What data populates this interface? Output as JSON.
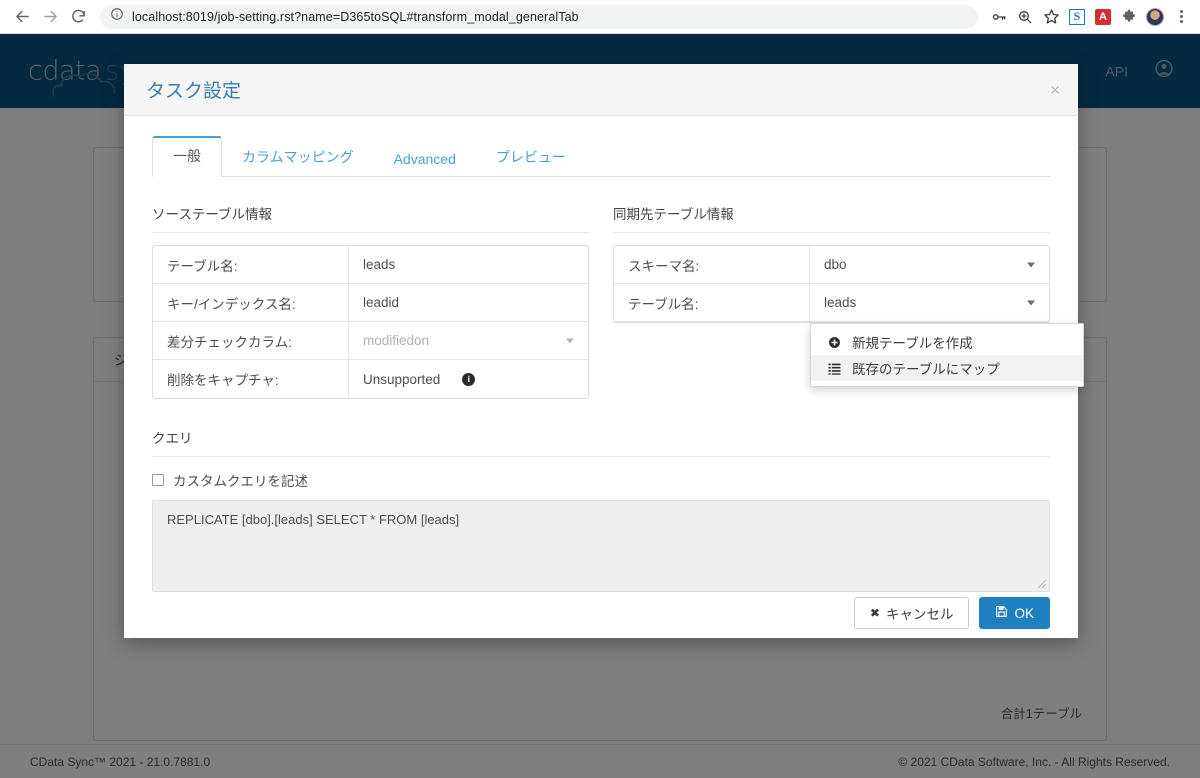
{
  "browser": {
    "back_icon": "arrow-left-icon",
    "forward_icon": "arrow-right-icon",
    "reload_icon": "reload-icon",
    "site_info_icon": "info-circle-icon",
    "url_host": "localhost:8019",
    "url_path": "/job-setting.rst?name=D365toSQL#transform_modal_generalTab",
    "url_full": "localhost:8019/job-setting.rst?name=D365toSQL#transform_modal_generalTab",
    "actions": [
      {
        "name": "password-key-icon",
        "glyph": "key"
      },
      {
        "name": "zoom-search-icon",
        "glyph": "magnifier"
      },
      {
        "name": "bookmark-star-icon",
        "glyph": "star"
      },
      {
        "name": "extension-s-icon",
        "label": "S"
      },
      {
        "name": "adobe-pdf-extension-icon",
        "label": "A"
      },
      {
        "name": "extensions-puzzle-icon",
        "glyph": "puzzle"
      },
      {
        "name": "profile-avatar",
        "glyph": "avatar"
      },
      {
        "name": "chrome-menu-icon",
        "glyph": "kebab"
      }
    ]
  },
  "navbar": {
    "brand_word": "cdata",
    "brand_product": "sync",
    "api_label": "API",
    "user_icon": "user-account-icon"
  },
  "page": {
    "jobs_panel_title": "ジ",
    "table_total": "合計1テーブル",
    "footer_left": "CData Sync™ 2021 - 21.0.7881.0",
    "footer_right": "© 2021 CData Software, Inc. - All Rights Reserved."
  },
  "modal": {
    "title": "タスク設定",
    "close_label": "×",
    "tabs": [
      {
        "label": "一般",
        "active": true
      },
      {
        "label": "カラムマッピング",
        "active": false
      },
      {
        "label": "Advanced",
        "active": false
      },
      {
        "label": "プレビュー",
        "active": false
      }
    ],
    "source_section": {
      "heading": "ソーステーブル情報",
      "rows": [
        {
          "label": "テーブル名:",
          "value": "leads",
          "type": "text"
        },
        {
          "label": "キー/インデックス名:",
          "value": "leadid",
          "type": "text"
        },
        {
          "label": "差分チェックカラム:",
          "value": "modifiedon",
          "type": "select-muted"
        },
        {
          "label": "削除をキャプチャ:",
          "value": "Unsupported",
          "type": "text-info",
          "info": "i"
        }
      ]
    },
    "destination_section": {
      "heading": "同期先テーブル情報",
      "rows": [
        {
          "label": "スキーマ名:",
          "value": "dbo",
          "type": "select"
        },
        {
          "label": "テーブル名:",
          "value": "leads",
          "type": "select"
        }
      ],
      "dropdown": {
        "open": true,
        "items": [
          {
            "label": "新規テーブルを作成",
            "icon": "plus-circle-icon",
            "hover": false
          },
          {
            "label": "既存のテーブルにマップ",
            "icon": "list-bars-icon",
            "hover": true
          }
        ]
      }
    },
    "query_section": {
      "heading": "クエリ",
      "custom_query_label": "カスタムクエリを記述",
      "custom_query_checked": false,
      "query_text": "REPLICATE [dbo].[leads] SELECT * FROM [leads]"
    },
    "footer": {
      "cancel_label": "キャンセル",
      "ok_label": "OK"
    }
  },
  "colors": {
    "navbar": "#0b5480",
    "accent_blue": "#1e80c0",
    "tab_link": "#4a9fd4",
    "title_blue": "#3a7ca8"
  }
}
